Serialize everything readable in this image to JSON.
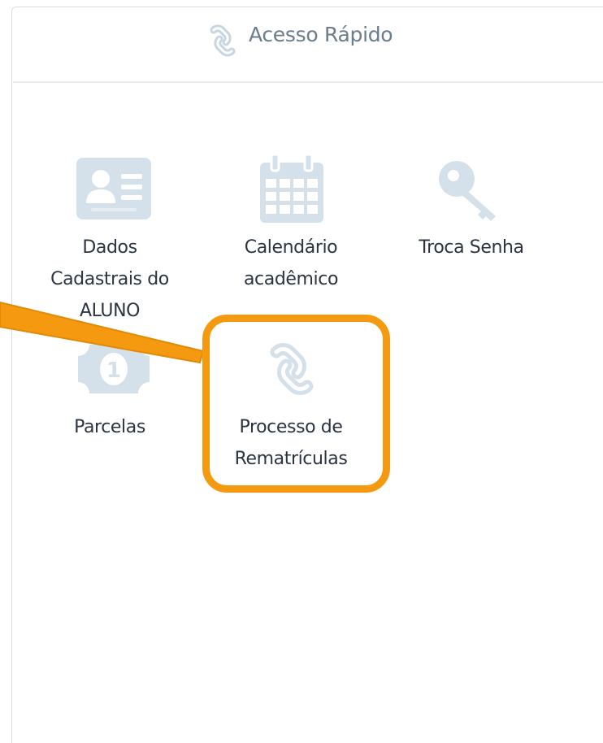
{
  "panel": {
    "title": "Acesso Rápido",
    "title_icon": "link-icon"
  },
  "tiles": [
    {
      "label": "Dados Cadastrais do ALUNO",
      "lines": [
        "Dados",
        "Cadastrais do",
        "ALUNO"
      ],
      "icon": "id-card-icon"
    },
    {
      "label": "Calendário acadêmico",
      "lines": [
        "Calendário",
        "acadêmico"
      ],
      "icon": "calendar-icon"
    },
    {
      "label": "Troca Senha",
      "lines": [
        "Troca Senha"
      ],
      "icon": "key-icon"
    },
    {
      "label": "Parcelas",
      "lines": [
        "Parcelas"
      ],
      "icon": "money-bill-icon"
    },
    {
      "label": "Processo de Rematrículas",
      "lines": [
        "Processo de",
        "Rematrículas"
      ],
      "icon": "link-icon"
    }
  ],
  "annotation": {
    "highlighted_tile": "Processo de Rematrículas",
    "highlight_color": "#F59A10"
  },
  "colors": {
    "icon_color": "#D5E1EA",
    "title_color": "#6B7C8D",
    "label_color": "#2B3440",
    "border_color": "#D7DDE3"
  }
}
